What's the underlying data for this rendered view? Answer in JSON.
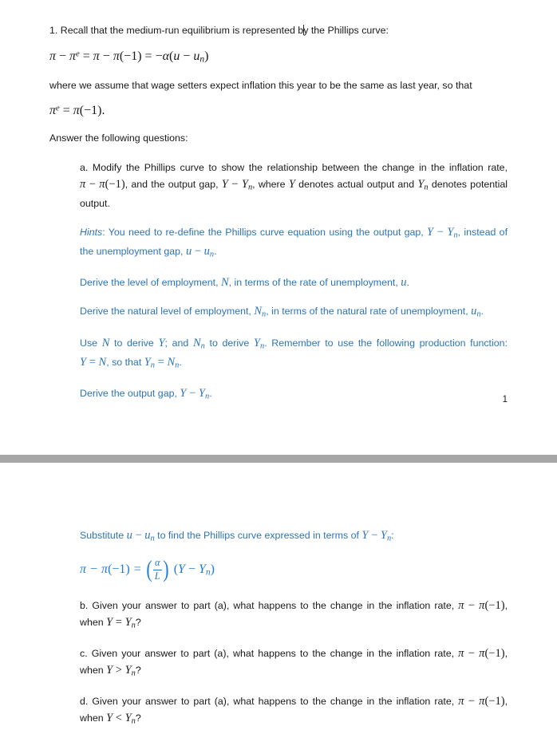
{
  "document": {
    "colors": {
      "body_text": "#1a1a1a",
      "hint_blue": "#2e74b5",
      "equation_blue": "#1f7ad4",
      "page_separator": "#a6a6a6",
      "page_background": "#ffffff"
    }
  },
  "page1": {
    "question_intro": "1. Recall that the medium-run equilibrium is represented b",
    "question_intro_after_caret": "y the Phillips curve:",
    "equation_1": {
      "lhs_pi": "π",
      "minus": "−",
      "pi_e": "π",
      "sup_e": "e",
      "eq": "=",
      "pi2": "π",
      "pi3": "π",
      "open": "(",
      "neg_one": "−1",
      "close": ")",
      "eq2": "=",
      "neg": "−",
      "alpha": "α",
      "open2": "(",
      "u": "u",
      "minus2": "−",
      "u_n": "u",
      "sub_n": "n",
      "close2": ")"
    },
    "assumption_text": "where we assume that wage setters expect inflation this year to be the same as last year, so that",
    "equation_2": {
      "pi": "π",
      "sup_e": "e",
      "eq": "=",
      "pi2": "π",
      "open": "(",
      "neg_one": "−1",
      "close": ")",
      "period": "."
    },
    "answer_prompt": "Answer the following questions:",
    "part_a": {
      "text_1": "a. Modify the Phillips curve to show the relationship between the change in the inflation rate, ",
      "math_1_pi": "π",
      "math_1_minus": "−",
      "math_1_pi2": "π",
      "math_1_open": "(",
      "math_1_negone": "−1",
      "math_1_close": ")",
      "text_2": ", and the output gap, ",
      "math_2_Y": "Y",
      "math_2_minus": "−",
      "math_2_Yn": "Y",
      "math_2_sub": "n",
      "text_3": ", where ",
      "math_3_Y": "Y",
      "text_4": " denotes actual output and ",
      "math_4_Yn": "Y",
      "math_4_sub": "n",
      "text_5": " denotes potential output."
    },
    "hint_1": {
      "label": "Hints",
      "text_1": ": You need to re-define the Phillips curve equation using the output gap, ",
      "math_Y": "Y",
      "math_minus": "−",
      "math_Yn": "Y",
      "math_sub": "n",
      "text_2": ", instead of the unemployment gap, ",
      "math_u": "u",
      "math_minus2": "−",
      "math_un": "u",
      "math_sub2": "n",
      "text_3": "."
    },
    "hint_2": {
      "text_1": "Derive the level of employment, ",
      "math_N": "N",
      "text_2": ", in terms of the rate of unemployment, ",
      "math_u": "u",
      "text_3": "."
    },
    "hint_3": {
      "text_1": "Derive the natural level of employment, ",
      "math_Nn": "N",
      "math_sub": "n",
      "text_2": ", in terms of the natural rate of unemployment, ",
      "math_un": "u",
      "math_sub2": "n",
      "text_3": "."
    },
    "hint_4": {
      "text_1": "Use ",
      "math_N": "N",
      "text_2": " to derive ",
      "math_Y": "Y",
      "text_3": "; and ",
      "math_Nn": "N",
      "math_sub": "n",
      "text_4": " to derive ",
      "math_Yn": "Y",
      "math_sub2": "n",
      "text_5": ". Remember to use the following production function: ",
      "math_Y2": "Y",
      "math_eq": "=",
      "math_N2": "N",
      "text_6": ", so that ",
      "math_Yn2": "Y",
      "math_sub3": "n",
      "math_eq2": "=",
      "math_Nn2": "N",
      "math_sub4": "n",
      "text_7": "."
    },
    "hint_5": {
      "text_1": "Derive the output gap, ",
      "math_Y": "Y",
      "math_minus": "−",
      "math_Yn": "Y",
      "math_sub": "n",
      "text_2": "."
    },
    "page_number": "1"
  },
  "page2": {
    "hint_substitute": {
      "text_1": "Substitute ",
      "math_u": "u",
      "math_minus": "−",
      "math_un": "u",
      "math_sub": "n",
      "text_2": " to find the Phillips curve expressed in terms of ",
      "math_Y": "Y",
      "math_minus2": "−",
      "math_Yn": "Y",
      "math_sub2": "n",
      "text_3": ":"
    },
    "equation_3": {
      "pi": "π",
      "minus": "−",
      "pi2": "π",
      "open": "(",
      "neg_one": "−1",
      "close": ")",
      "eq": "=",
      "frac_numerator": "α",
      "frac_denominator": "L",
      "paren_open": "(",
      "paren_close": ")",
      "group_open": "(",
      "Y": "Y",
      "minus2": "−",
      "Yn": "Y",
      "sub_n": "n",
      "group_close": ")"
    },
    "part_b": {
      "text_1": "b. Given your answer to part (a), what happens to the change in the inflation rate, ",
      "math_pi": "π",
      "math_minus": "−",
      "math_pi2": "π",
      "math_open": "(",
      "math_negone": "−1",
      "math_close": ")",
      "text_2": ", when ",
      "math_Y": "Y",
      "math_rel": "=",
      "math_Yn": "Y",
      "math_sub": "n",
      "text_3": "?"
    },
    "part_c": {
      "text_1": "c. Given your answer to part (a), what happens to the change in the inflation rate, ",
      "math_pi": "π",
      "math_minus": "−",
      "math_pi2": "π",
      "math_open": "(",
      "math_negone": "−1",
      "math_close": ")",
      "text_2": ", when ",
      "math_Y": "Y",
      "math_rel": ">",
      "math_Yn": "Y",
      "math_sub": "n",
      "text_3": "?"
    },
    "part_d": {
      "text_1": "d. Given your answer to part (a), what happens to the change in the inflation rate, ",
      "math_pi": "π",
      "math_minus": "−",
      "math_pi2": "π",
      "math_open": "(",
      "math_negone": "−1",
      "math_close": ")",
      "text_2": ", when ",
      "math_Y": "Y",
      "math_rel": "<",
      "math_Yn": "Y",
      "math_sub": "n",
      "text_3": "?"
    }
  }
}
